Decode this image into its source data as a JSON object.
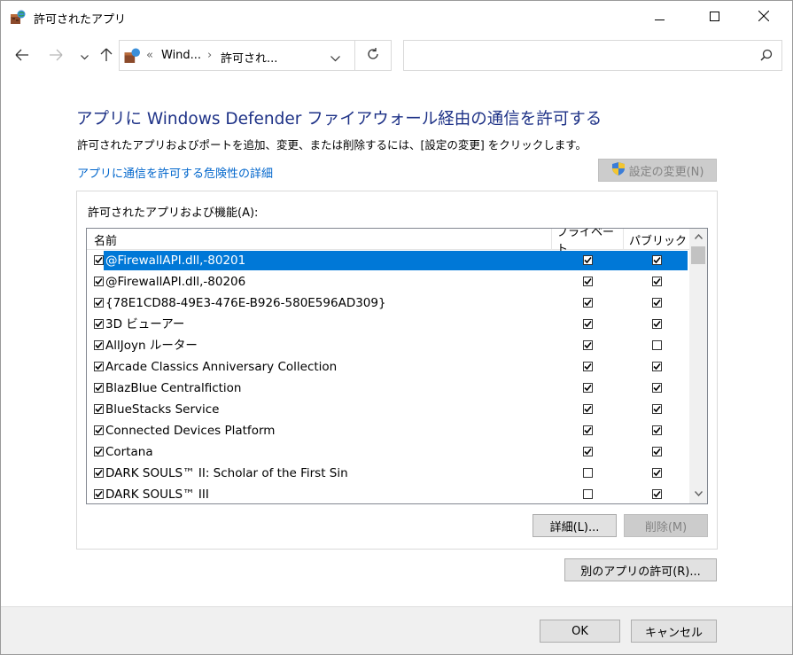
{
  "window": {
    "title": "許可されたアプリ",
    "icon": "firewall-app-icon"
  },
  "titlebar": {
    "minimize_icon": "minimize-icon",
    "maximize_icon": "maximize-icon",
    "close_icon": "close-icon"
  },
  "nav": {
    "back_icon": "arrow-left-icon",
    "forward_icon": "arrow-right-icon",
    "recent_icon": "chevron-down-icon",
    "up_icon": "arrow-up-icon",
    "breadcrumb_prefix": "«",
    "breadcrumb_1": "Wind...",
    "breadcrumb_sep": "›",
    "breadcrumb_2": "許可され...",
    "dropdown_icon": "chevron-down-icon",
    "refresh_icon": "refresh-icon",
    "search_placeholder": "",
    "search_icon": "search-icon"
  },
  "main": {
    "heading": "アプリに Windows Defender ファイアウォール経由の通信を許可する",
    "description": "許可されたアプリおよびポートを追加、変更、または削除するには、[設定の変更] をクリックします。",
    "risk_link": "アプリに通信を許可する危険性の詳細",
    "change_settings_label": "設定の変更(N)",
    "group_label": "許可されたアプリおよび機能(A):",
    "columns": {
      "name": "名前",
      "private": "プライベート",
      "public": "パブリック"
    },
    "apps": [
      {
        "name": "@FirewallAPI.dll,-80201",
        "enabled": true,
        "private": true,
        "public": true,
        "selected": true
      },
      {
        "name": "@FirewallAPI.dll,-80206",
        "enabled": true,
        "private": true,
        "public": true
      },
      {
        "name": "{78E1CD88-49E3-476E-B926-580E596AD309}",
        "enabled": true,
        "private": true,
        "public": true
      },
      {
        "name": "3D ビューアー",
        "enabled": true,
        "private": true,
        "public": true
      },
      {
        "name": "AllJoyn ルーター",
        "enabled": true,
        "private": true,
        "public": false
      },
      {
        "name": "Arcade Classics Anniversary Collection",
        "enabled": true,
        "private": true,
        "public": true
      },
      {
        "name": "BlazBlue Centralfiction",
        "enabled": true,
        "private": true,
        "public": true
      },
      {
        "name": "BlueStacks Service",
        "enabled": true,
        "private": true,
        "public": true
      },
      {
        "name": "Connected Devices Platform",
        "enabled": true,
        "private": true,
        "public": true
      },
      {
        "name": "Cortana",
        "enabled": true,
        "private": true,
        "public": true
      },
      {
        "name": "DARK SOULS™ II: Scholar of the First Sin",
        "enabled": true,
        "private": false,
        "public": true
      },
      {
        "name": "DARK SOULS™ III",
        "enabled": true,
        "private": false,
        "public": true
      }
    ],
    "details_label": "詳細(L)...",
    "delete_label": "削除(M)",
    "allow_another_label": "別のアプリの許可(R)..."
  },
  "footer": {
    "ok_label": "OK",
    "cancel_label": "キャンセル"
  },
  "colors": {
    "heading": "#1e3287",
    "link": "#0066cc",
    "selection": "#0078d7"
  }
}
